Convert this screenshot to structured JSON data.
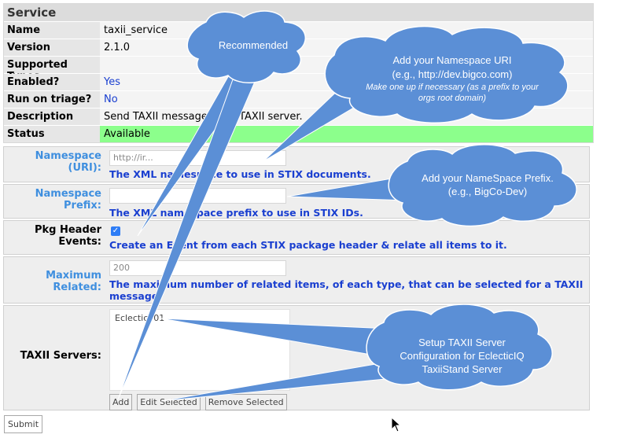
{
  "service": {
    "header": "Service",
    "rows": [
      {
        "label": "Name",
        "value": "taxii_service"
      },
      {
        "label": "Version",
        "value": "2.1.0"
      },
      {
        "label": "Supported Types",
        "value": ""
      },
      {
        "label": "Enabled?",
        "value": "Yes"
      },
      {
        "label": "Run on triage?",
        "value": "No"
      },
      {
        "label": "Description",
        "value": "Send TAXII messages to a TAXII server."
      },
      {
        "label": "Status",
        "value": "Available"
      }
    ],
    "status_color": "#8cff8c"
  },
  "form": {
    "namespace_uri": {
      "label1": "Namespace",
      "label2": "(URI):",
      "value": "http://ir...",
      "help": "The XML namespace to use in STIX documents."
    },
    "namespace_prefix": {
      "label1": "Namespace",
      "label2": "Prefix:",
      "value": "",
      "help": "The XML namespace prefix to use in STIX IDs."
    },
    "pkg_header": {
      "label1": "Pkg Header",
      "label2": "Events:",
      "checked": true,
      "help": "Create an Event from each STIX package header & relate all items to it."
    },
    "max_related": {
      "label1": "Maximum",
      "label2": "Related:",
      "value": "200",
      "help": "The maximum number of related items, of each type, that can be selected for a TAXII message."
    },
    "taxii_servers": {
      "label": "TAXII Servers:",
      "items": [
        "Eclectic001"
      ],
      "add": "Add",
      "edit": "Edit Selected",
      "remove": "Remove Selected"
    },
    "submit": "Submit"
  },
  "callouts": {
    "recommended": "Recommended",
    "namespace": [
      "Add your Namespace URI",
      "(e.g., http://dev.bigco.com)",
      "Make one up if necessary  (as a prefix to your",
      "orgs root domain)"
    ],
    "prefix": [
      "Add your NameSpace Prefix.",
      "(e.g., BigCo-Dev)"
    ],
    "taxii": [
      "Setup TAXII Server",
      "Configuration for EclecticIQ",
      "TaxiiStand Server"
    ],
    "fill": "#5b8fd6"
  }
}
